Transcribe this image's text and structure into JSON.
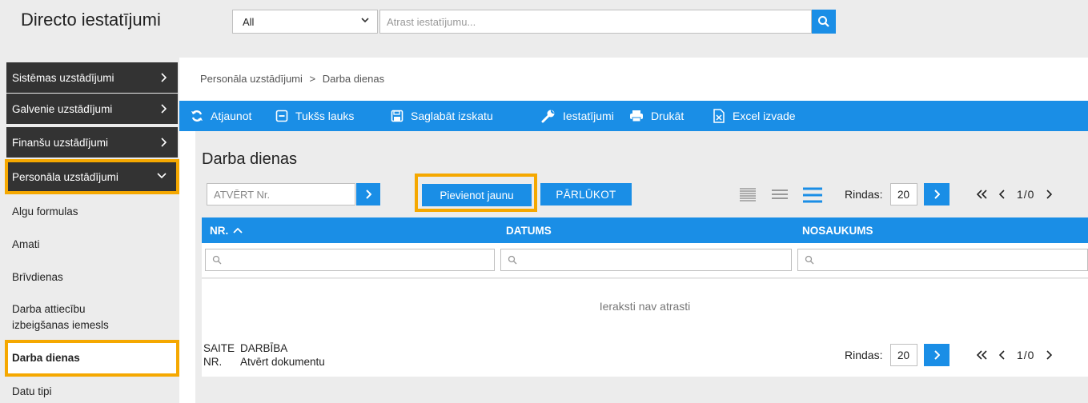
{
  "header": {
    "app_title": "Directo iestatījumi",
    "filter_value": "All",
    "search_placeholder": "Atrast iestatījumu..."
  },
  "sidebar": {
    "dark_items": [
      {
        "label": "Sistēmas uzstādījumi",
        "expanded": false
      },
      {
        "label": "Galvenie uzstādījumi",
        "expanded": false
      },
      {
        "label": "Finanšu uzstādījumi",
        "expanded": false
      },
      {
        "label": "Personāla uzstādījumi",
        "expanded": true,
        "highlighted": true
      }
    ],
    "sub_items": [
      {
        "label": "Algu formulas"
      },
      {
        "label": "Amati"
      },
      {
        "label": "Brīvdienas"
      },
      {
        "label": "Darba attiecību izbeigšanas iemesls"
      },
      {
        "label": "Darba dienas",
        "active": true,
        "highlighted": true
      },
      {
        "label": "Datu tipi"
      }
    ]
  },
  "breadcrumb": {
    "parent": "Personāla uzstādījumi",
    "separator": ">",
    "current": "Darba dienas"
  },
  "toolbar": {
    "refresh": "Atjaunot",
    "empty_field": "Tukšs lauks",
    "save_view": "Saglabāt izskatu",
    "settings": "Iestatījumi",
    "print": "Drukāt",
    "excel": "Excel izvade"
  },
  "page": {
    "title": "Darba dienas",
    "open_placeholder": "ATVĒRT Nr.",
    "add_new": "Pievienot jaunu",
    "browse": "PĀRLŪKOT",
    "rows_label": "Rindas:",
    "rows_value": "20",
    "pager_text": "1/0"
  },
  "table": {
    "columns": [
      "NR.",
      "DATUMS",
      "NOSAUKUMS"
    ],
    "empty_message": "Ieraksti nav atrasti"
  },
  "footer": {
    "col1_line1": "SAITE",
    "col1_line2": "NR.",
    "col2_line1": "DARBĪBA",
    "col2_line2": "Atvērt dokumentu"
  },
  "colors": {
    "accent": "#1a8ee6",
    "highlight": "#f5a800",
    "sidebar_dark": "#333333"
  }
}
